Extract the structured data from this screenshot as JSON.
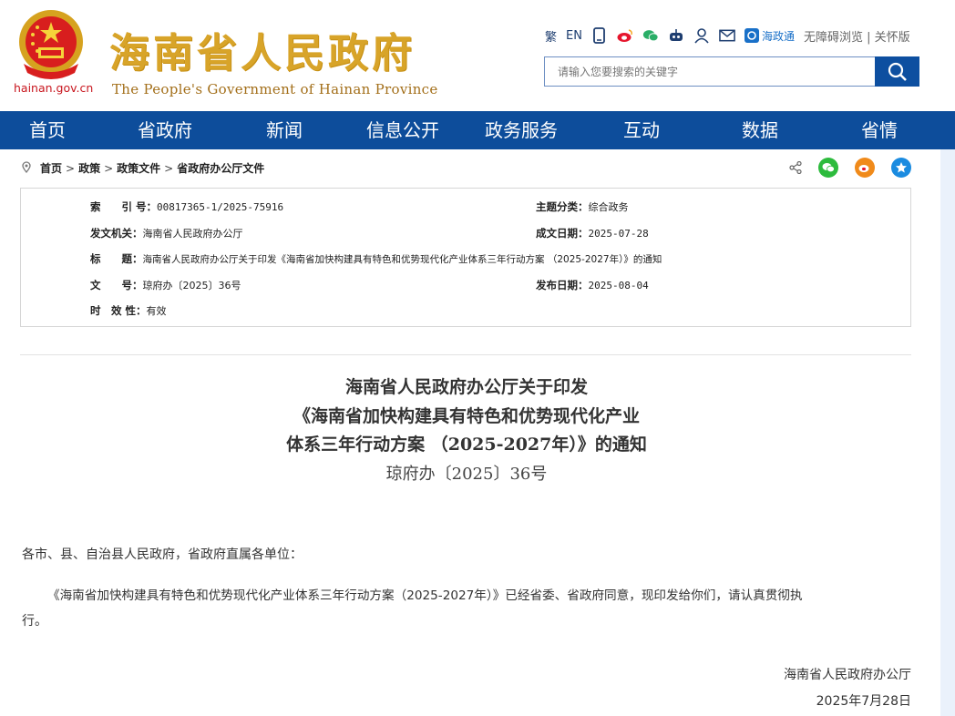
{
  "header": {
    "domain": "hainan.gov.cn",
    "logo_cn": "海南省人民政府",
    "logo_en": "The People's Government  of Hainan Province",
    "toolbar": {
      "traditional": "繁",
      "english": "EN",
      "hzt": "海政通",
      "accessible": "无障碍浏览",
      "sep": "|",
      "elder": "关怀版"
    },
    "search_placeholder": "请输入您要搜索的关键字"
  },
  "nav": [
    "首页",
    "省政府",
    "新闻",
    "信息公开",
    "政务服务",
    "互动",
    "数据",
    "省情"
  ],
  "breadcrumb": [
    "首页",
    "政策",
    "政策文件",
    "省政府办公厅文件"
  ],
  "info": {
    "index_label": "索　　引 号：",
    "index_value": "00817365-1/2025-75916",
    "category_label": "主题分类：",
    "category_value": "综合政务",
    "issuer_label": "发文机关：",
    "issuer_value": "海南省人民政府办公厅",
    "date_label": "成文日期：",
    "date_value": "2025-07-28",
    "title_label": "标　　题：",
    "title_value": "海南省人民政府办公厅关于印发《海南省加快构建具有特色和优势现代化产业体系三年行动方案 （2025-2027年）》的通知",
    "docno_label": "文　　号：",
    "docno_value": "琼府办〔2025〕36号",
    "publish_label": "发布日期：",
    "publish_value": "2025-08-04",
    "validity_label": "时　效 性：",
    "validity_value": "有效"
  },
  "doc": {
    "title_line1": "海南省人民政府办公厅关于印发",
    "title_line2": "《海南省加快构建具有特色和优势现代化产业",
    "title_line3": "体系三年行动方案 （2025-2027年）》的通知",
    "docno": "琼府办〔2025〕36号",
    "greeting": "各市、县、自治县人民政府，省政府直属各单位：",
    "body_line1": "《海南省加快构建具有特色和优势现代化产业体系三年行动方案（2025-2027年）》已经省委、省政府同意，现印发给你们，请认真贯彻执",
    "body_line2": "行。",
    "signer": "海南省人民政府办公厅",
    "sign_date": "2025年7月28日"
  },
  "colors": {
    "nav_bg": "#0d4d9b",
    "logo_gold": "#d8a429",
    "domain_red": "#c8161e"
  }
}
